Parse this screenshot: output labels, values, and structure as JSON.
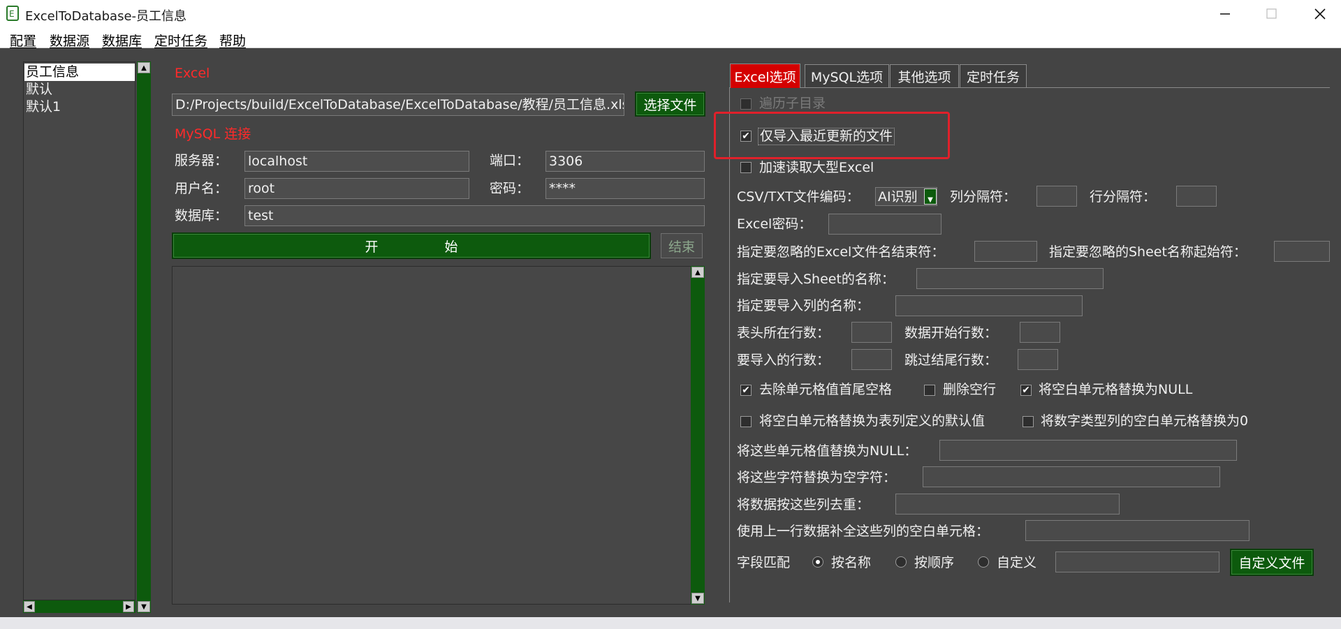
{
  "window": {
    "title": "ExcelToDatabase-员工信息",
    "minimize_icon": "minimize-icon",
    "maximize_icon": "maximize-icon",
    "close_icon": "close-icon",
    "app_icon": "excel-database-app-icon"
  },
  "menu": [
    "配置",
    "数据源",
    "数据库",
    "定时任务",
    "帮助"
  ],
  "config_list": [
    "员工信息",
    "默认",
    "默认1"
  ],
  "excel_section": {
    "label": "Excel",
    "path": "D:/Projects/build/ExcelToDatabase/ExcelToDatabase/教程/员工信息.xlsx",
    "choose_file_label": "选择文件"
  },
  "mysql_section": {
    "label": "MySQL 连接",
    "server_label": "服务器：",
    "server": "localhost",
    "port_label": "端口：",
    "port": "3306",
    "user_label": "用户名：",
    "user": "root",
    "password_label": "密码：",
    "password": "****",
    "db_label": "数据库：",
    "db": "test"
  },
  "start_label": "开　　　　　始",
  "end_label": "结束",
  "tabs": [
    "Excel选项",
    "MySQL选项",
    "其他选项",
    "定时任务"
  ],
  "options": {
    "traverse_subdirs": "遍历子目录",
    "only_recent": "仅导入最近更新的文件",
    "speed_read": "加速读取大型Excel",
    "csv_encoding_label": "CSV/TXT文件编码：",
    "csv_encoding_value": "AI识别",
    "col_sep_label": "列分隔符：",
    "row_sep_label": "行分隔符：",
    "excel_pwd_label": "Excel密码：",
    "ignore_filename_label": "指定要忽略的Excel文件名结束符：",
    "ignore_sheet_label": "指定要忽略的Sheet名称起始符：",
    "import_sheet_label": "指定要导入Sheet的名称：",
    "import_cols_label": "指定要导入列的名称：",
    "header_row_label": "表头所在行数：",
    "data_start_label": "数据开始行数：",
    "rows_to_import_label": "要导入的行数：",
    "skip_tail_label": "跳过结尾行数：",
    "trim_label": "去除单元格值首尾空格",
    "delete_empty_rows_label": "删除空行",
    "blank_to_null_label": "将空白单元格替换为NULL",
    "blank_to_default_label": "将空白单元格替换为表列定义的默认值",
    "blank_numeric_zero_label": "将数字类型列的空白单元格替换为0",
    "values_to_null_label": "将这些单元格值替换为NULL：",
    "chars_to_empty_label": "将这些字符替换为空字符：",
    "dedupe_label": "将数据按这些列去重：",
    "fill_from_prev_label": "使用上一行数据补全这些列的空白单元格：",
    "field_match_label": "字段匹配",
    "match_by_name": "按名称",
    "match_by_order": "按顺序",
    "match_custom": "自定义",
    "custom_file_label": "自定义文件"
  },
  "colors": {
    "highlight": "#e0202a",
    "accent_green": "#0d5a0d",
    "active_tab": "#d40000"
  }
}
